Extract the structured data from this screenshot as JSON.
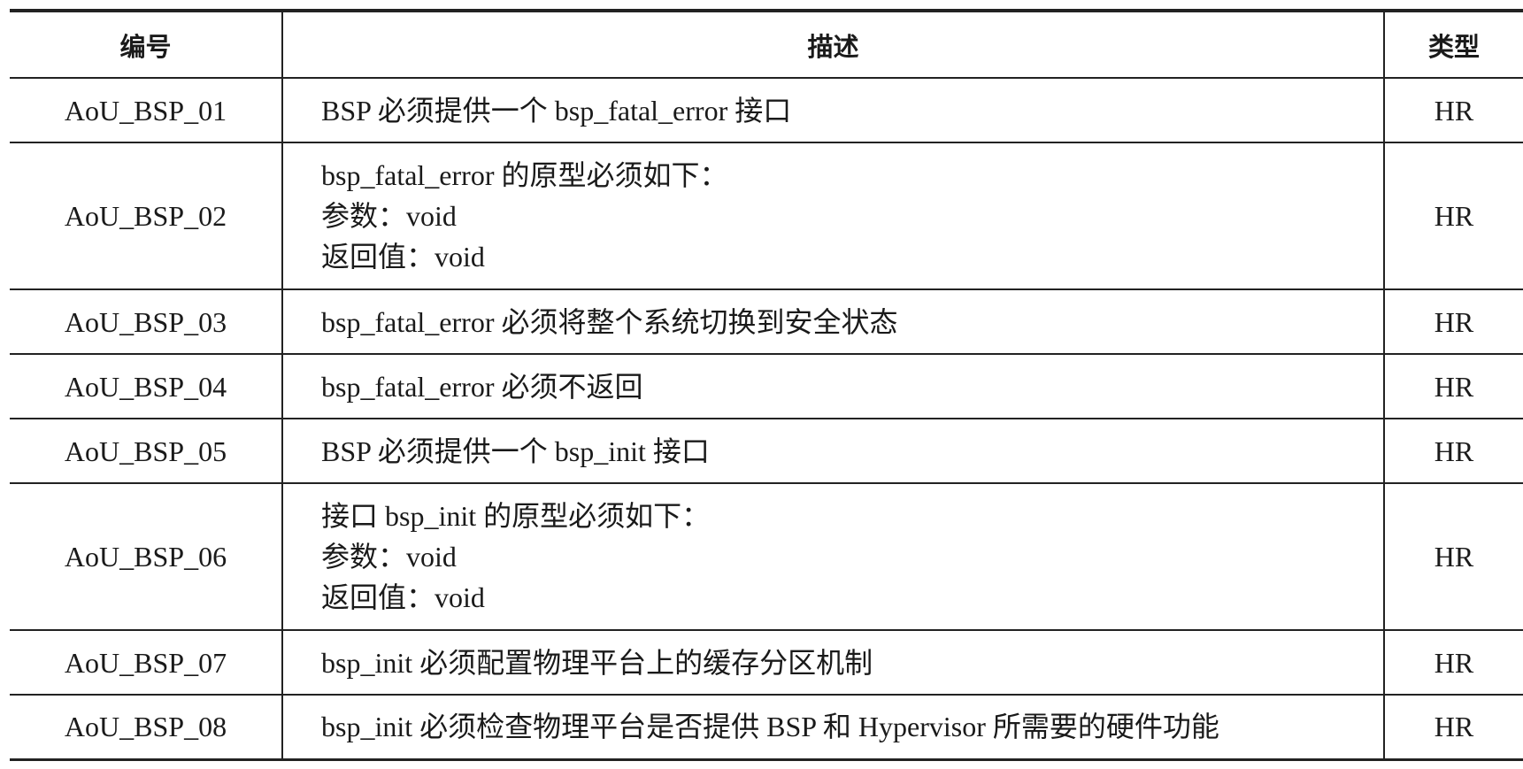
{
  "table": {
    "headers": {
      "id": "编号",
      "description": "描述",
      "type": "类型"
    },
    "rows": [
      {
        "id": "AoU_BSP_01",
        "description": [
          "BSP 必须提供一个 bsp_fatal_error 接口"
        ],
        "type": "HR"
      },
      {
        "id": "AoU_BSP_02",
        "description": [
          "bsp_fatal_error 的原型必须如下：",
          "参数：void",
          "返回值：void"
        ],
        "type": "HR"
      },
      {
        "id": "AoU_BSP_03",
        "description": [
          "bsp_fatal_error 必须将整个系统切换到安全状态"
        ],
        "type": "HR"
      },
      {
        "id": "AoU_BSP_04",
        "description": [
          "bsp_fatal_error 必须不返回"
        ],
        "type": "HR"
      },
      {
        "id": "AoU_BSP_05",
        "description": [
          "BSP 必须提供一个 bsp_init 接口"
        ],
        "type": "HR"
      },
      {
        "id": "AoU_BSP_06",
        "description": [
          "接口 bsp_init 的原型必须如下：",
          "参数：void",
          "返回值：void"
        ],
        "type": "HR"
      },
      {
        "id": "AoU_BSP_07",
        "description": [
          "bsp_init 必须配置物理平台上的缓存分区机制"
        ],
        "type": "HR"
      },
      {
        "id": "AoU_BSP_08",
        "description": [
          "bsp_init 必须检查物理平台是否提供 BSP 和 Hypervisor 所需要的硬件功能"
        ],
        "type": "HR"
      }
    ]
  }
}
